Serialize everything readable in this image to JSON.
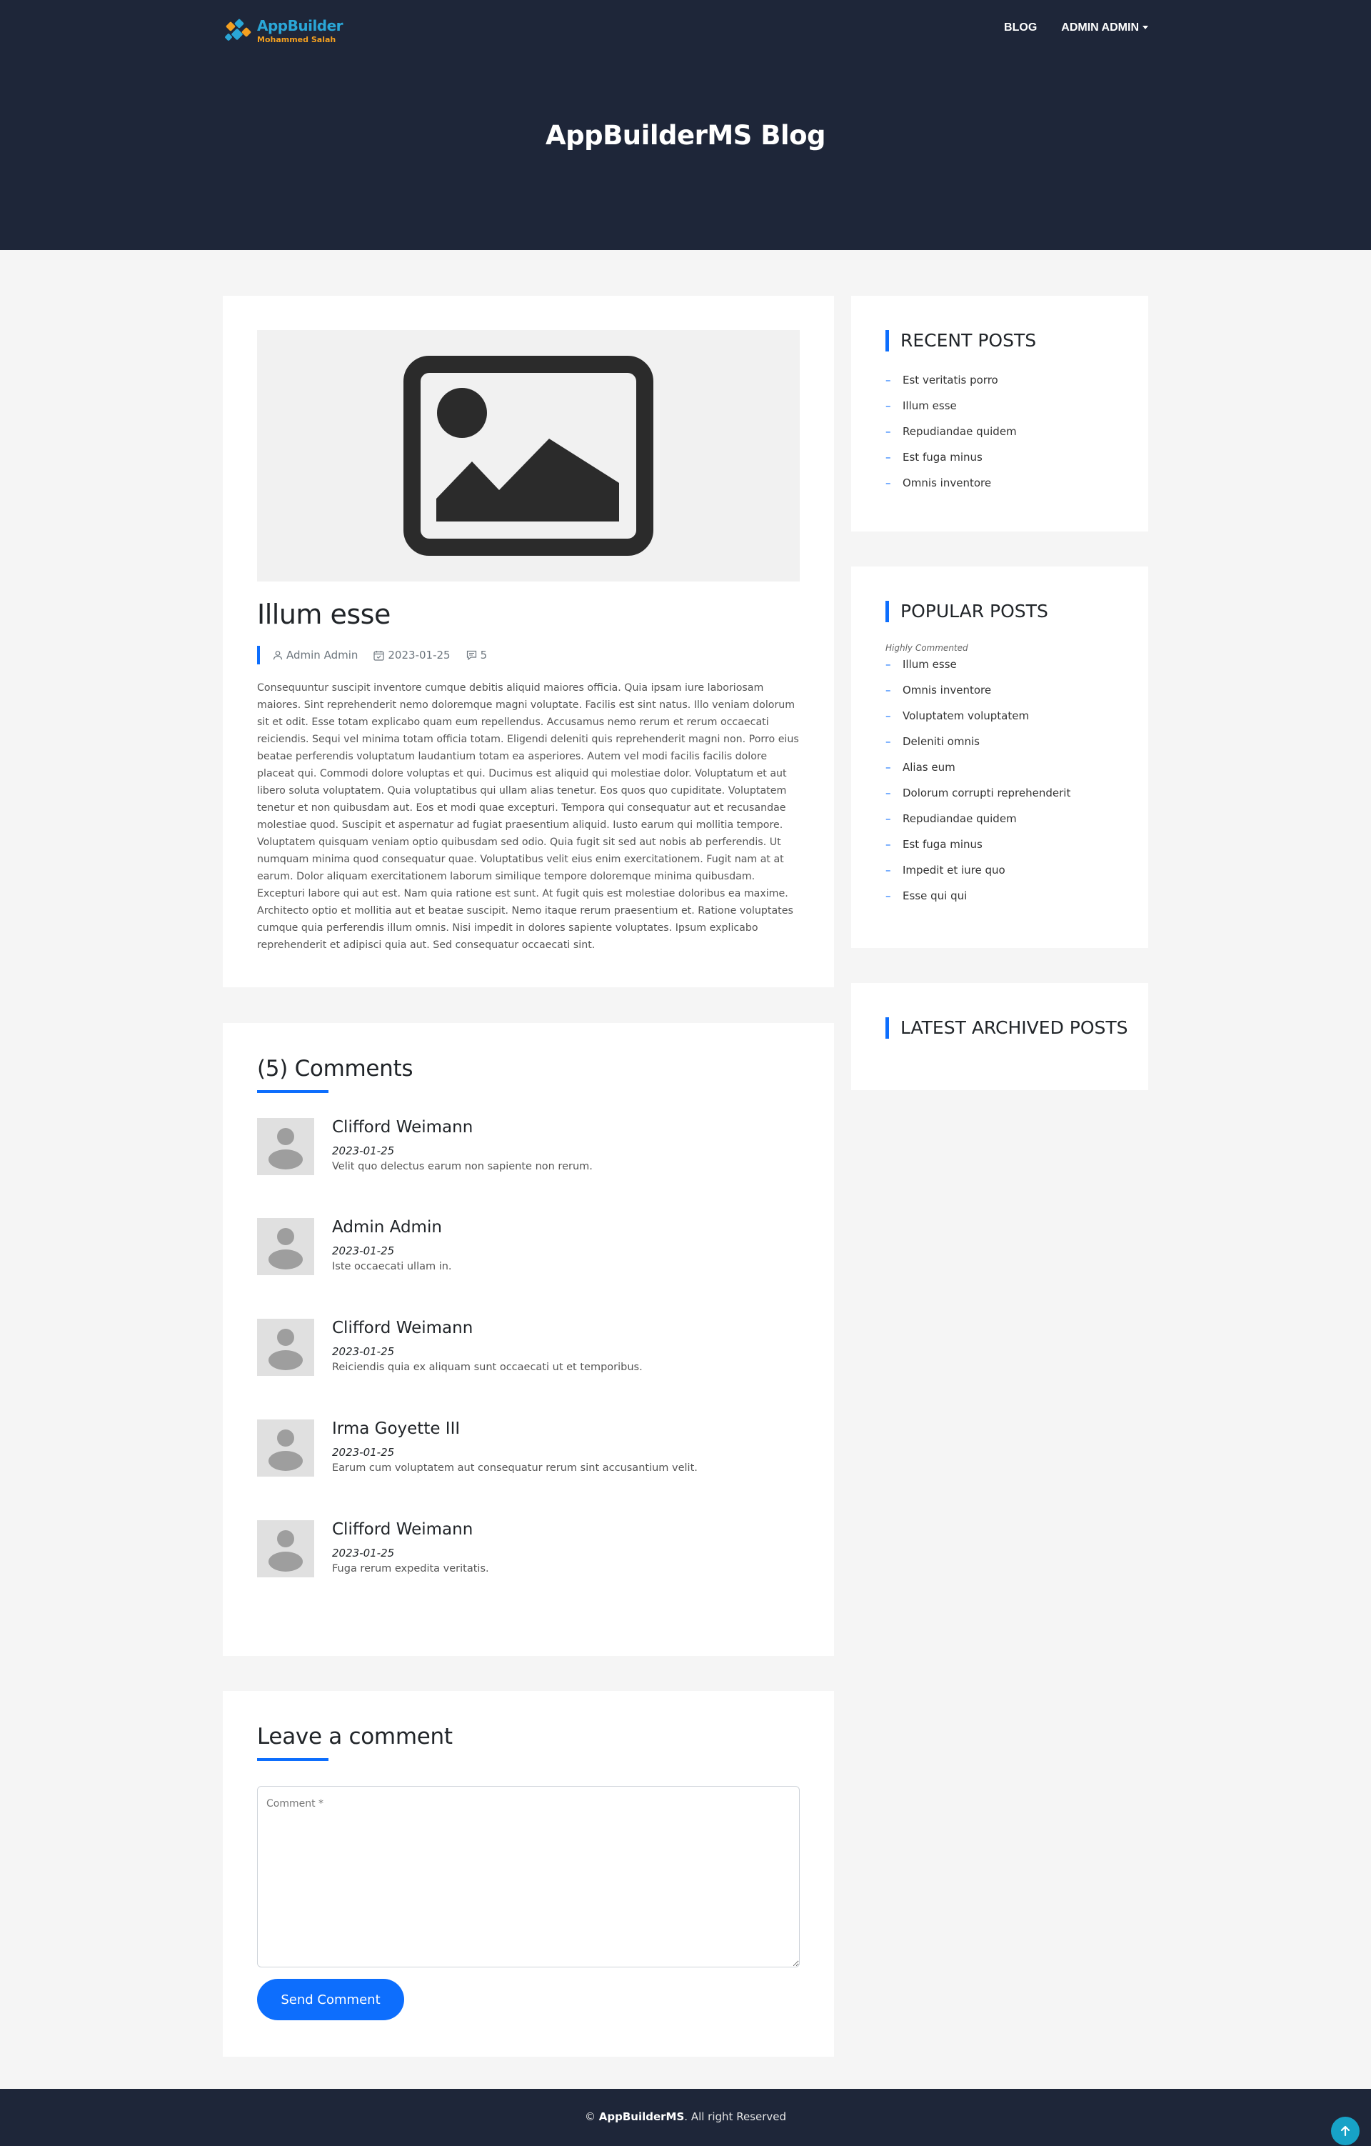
{
  "header": {
    "logo_title": "AppBuilder",
    "logo_subtitle": "Mohammed Salah",
    "nav": {
      "blog": "BLOG",
      "user": "ADMIN ADMIN"
    },
    "hero_title": "AppBuilderMS Blog"
  },
  "post": {
    "title": "Illum esse",
    "author": "Admin Admin",
    "date": "2023-01-25",
    "comments_count": "5",
    "body": "Consequuntur suscipit inventore cumque debitis aliquid maiores officia. Quia ipsam iure laboriosam maiores. Sint reprehenderit nemo doloremque magni voluptate. Facilis est sint natus. Illo veniam dolorum sit et odit. Esse totam explicabo quam eum repellendus. Accusamus nemo rerum et rerum occaecati reiciendis. Sequi vel minima totam officia totam. Eligendi deleniti quis reprehenderit magni non. Porro eius beatae perferendis voluptatum laudantium totam ea asperiores. Autem vel modi facilis facilis dolore placeat qui. Commodi dolore voluptas et qui. Ducimus est aliquid qui molestiae dolor. Voluptatum et aut libero soluta voluptatem. Quia voluptatibus qui ullam alias tenetur. Eos quos quo cupiditate. Voluptatem tenetur et non quibusdam aut. Eos et modi quae excepturi. Tempora qui consequatur aut et recusandae molestiae quod. Suscipit et aspernatur ad fugiat praesentium aliquid. Iusto earum qui mollitia tempore. Voluptatem quisquam veniam optio quibusdam sed odio. Quia fugit sit sed aut nobis ab perferendis. Ut numquam minima quod consequatur quae. Voluptatibus velit eius enim exercitationem. Fugit nam at at earum. Dolor aliquam exercitationem laborum similique tempore doloremque minima quibusdam. Excepturi labore qui aut est. Nam quia ratione est sunt. At fugit quis est molestiae doloribus ea maxime. Architecto optio et mollitia aut et beatae suscipit. Nemo itaque rerum praesentium et. Ratione voluptates cumque quia perferendis illum omnis. Nisi impedit in dolores sapiente voluptates. Ipsum explicabo reprehenderit et adipisci quia aut. Sed consequatur occaecati sint."
  },
  "comments": {
    "heading": "(5) Comments",
    "items": [
      {
        "name": "Clifford Weimann",
        "date": "2023-01-25",
        "text": "Velit quo delectus earum non sapiente non rerum."
      },
      {
        "name": "Admin Admin",
        "date": "2023-01-25",
        "text": "Iste occaecati ullam in."
      },
      {
        "name": "Clifford Weimann",
        "date": "2023-01-25",
        "text": "Reiciendis quia ex aliquam sunt occaecati ut et temporibus."
      },
      {
        "name": "Irma Goyette III",
        "date": "2023-01-25",
        "text": "Earum cum voluptatem aut consequatur rerum sint accusantium velit."
      },
      {
        "name": "Clifford Weimann",
        "date": "2023-01-25",
        "text": "Fuga rerum expedita veritatis."
      }
    ]
  },
  "form": {
    "heading": "Leave a comment",
    "placeholder": "Comment *",
    "submit_label": "Send Comment"
  },
  "sidebar": {
    "recent": {
      "heading": "Recent Posts",
      "items": [
        "Est veritatis porro",
        "Illum esse",
        "Repudiandae quidem",
        "Est fuga minus",
        "Omnis inventore"
      ]
    },
    "popular": {
      "heading": "Popular Posts",
      "subheading": "Highly Commented",
      "items": [
        "Illum esse",
        "Omnis inventore",
        "Voluptatem voluptatem",
        "Deleniti omnis",
        "Alias eum",
        "Dolorum corrupti reprehenderit",
        "Repudiandae quidem",
        "Est fuga minus",
        "Impedit et iure quo",
        "Esse qui qui"
      ]
    },
    "archived": {
      "heading": "Latest Archived Posts"
    }
  },
  "footer": {
    "copyright": "©",
    "brand": "AppBuilderMS",
    "rights": ". All right Reserved"
  },
  "colors": {
    "navy": "#1e2639",
    "accent": "#0d6efd",
    "scroll_top": "#17a2c7"
  },
  "icons": [
    "logo-icon",
    "user-icon",
    "calendar-icon",
    "comment-icon",
    "image-placeholder-icon",
    "arrow-up-icon"
  ]
}
